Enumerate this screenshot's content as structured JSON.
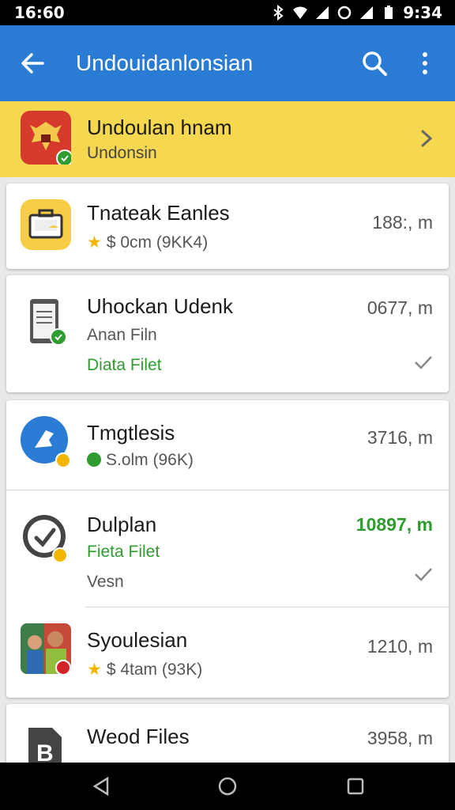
{
  "status_bar": {
    "time": "16:60",
    "clock_right": "9:34"
  },
  "app_bar": {
    "title": "Undouidanlonsian"
  },
  "banner": {
    "title": "Undoulan hnam",
    "subtitle": "Undonsin"
  },
  "list": [
    {
      "name": "Tnateak Eanles",
      "meta": "$ 0cm (9KK4)",
      "size": "188:, m"
    },
    {
      "name": "Uhockan Udenk",
      "meta": "Anan Filn",
      "meta2": "Diata Filet",
      "size": "0677, m"
    },
    {
      "name": "Tmgtlesis",
      "meta": "S.olm (96K)",
      "size": "3716, m"
    },
    {
      "name": "Dulplan",
      "meta": "Fieta Filet",
      "meta2": "Vesn",
      "size": "10897, m"
    },
    {
      "name": "Syoulesian",
      "meta": "$ 4tam (93K)",
      "size": "1210, m"
    },
    {
      "name": "Weod Files",
      "meta": "",
      "size": "3958, m"
    }
  ],
  "colors": {
    "app_bar": "#2a7bd4",
    "banner": "#f5d84f",
    "accent_green": "#2e9c2e",
    "star": "#f2b600"
  }
}
